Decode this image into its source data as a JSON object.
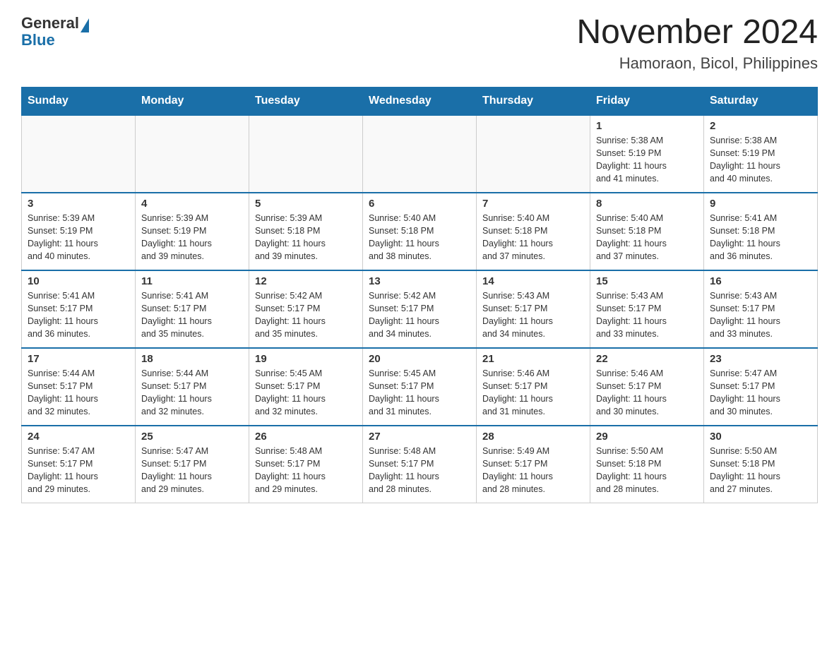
{
  "logo": {
    "general": "General",
    "blue": "Blue"
  },
  "header": {
    "month_year": "November 2024",
    "location": "Hamoraon, Bicol, Philippines"
  },
  "days_of_week": [
    "Sunday",
    "Monday",
    "Tuesday",
    "Wednesday",
    "Thursday",
    "Friday",
    "Saturday"
  ],
  "weeks": [
    [
      {
        "day": "",
        "info": ""
      },
      {
        "day": "",
        "info": ""
      },
      {
        "day": "",
        "info": ""
      },
      {
        "day": "",
        "info": ""
      },
      {
        "day": "",
        "info": ""
      },
      {
        "day": "1",
        "info": "Sunrise: 5:38 AM\nSunset: 5:19 PM\nDaylight: 11 hours\nand 41 minutes."
      },
      {
        "day": "2",
        "info": "Sunrise: 5:38 AM\nSunset: 5:19 PM\nDaylight: 11 hours\nand 40 minutes."
      }
    ],
    [
      {
        "day": "3",
        "info": "Sunrise: 5:39 AM\nSunset: 5:19 PM\nDaylight: 11 hours\nand 40 minutes."
      },
      {
        "day": "4",
        "info": "Sunrise: 5:39 AM\nSunset: 5:19 PM\nDaylight: 11 hours\nand 39 minutes."
      },
      {
        "day": "5",
        "info": "Sunrise: 5:39 AM\nSunset: 5:18 PM\nDaylight: 11 hours\nand 39 minutes."
      },
      {
        "day": "6",
        "info": "Sunrise: 5:40 AM\nSunset: 5:18 PM\nDaylight: 11 hours\nand 38 minutes."
      },
      {
        "day": "7",
        "info": "Sunrise: 5:40 AM\nSunset: 5:18 PM\nDaylight: 11 hours\nand 37 minutes."
      },
      {
        "day": "8",
        "info": "Sunrise: 5:40 AM\nSunset: 5:18 PM\nDaylight: 11 hours\nand 37 minutes."
      },
      {
        "day": "9",
        "info": "Sunrise: 5:41 AM\nSunset: 5:18 PM\nDaylight: 11 hours\nand 36 minutes."
      }
    ],
    [
      {
        "day": "10",
        "info": "Sunrise: 5:41 AM\nSunset: 5:17 PM\nDaylight: 11 hours\nand 36 minutes."
      },
      {
        "day": "11",
        "info": "Sunrise: 5:41 AM\nSunset: 5:17 PM\nDaylight: 11 hours\nand 35 minutes."
      },
      {
        "day": "12",
        "info": "Sunrise: 5:42 AM\nSunset: 5:17 PM\nDaylight: 11 hours\nand 35 minutes."
      },
      {
        "day": "13",
        "info": "Sunrise: 5:42 AM\nSunset: 5:17 PM\nDaylight: 11 hours\nand 34 minutes."
      },
      {
        "day": "14",
        "info": "Sunrise: 5:43 AM\nSunset: 5:17 PM\nDaylight: 11 hours\nand 34 minutes."
      },
      {
        "day": "15",
        "info": "Sunrise: 5:43 AM\nSunset: 5:17 PM\nDaylight: 11 hours\nand 33 minutes."
      },
      {
        "day": "16",
        "info": "Sunrise: 5:43 AM\nSunset: 5:17 PM\nDaylight: 11 hours\nand 33 minutes."
      }
    ],
    [
      {
        "day": "17",
        "info": "Sunrise: 5:44 AM\nSunset: 5:17 PM\nDaylight: 11 hours\nand 32 minutes."
      },
      {
        "day": "18",
        "info": "Sunrise: 5:44 AM\nSunset: 5:17 PM\nDaylight: 11 hours\nand 32 minutes."
      },
      {
        "day": "19",
        "info": "Sunrise: 5:45 AM\nSunset: 5:17 PM\nDaylight: 11 hours\nand 32 minutes."
      },
      {
        "day": "20",
        "info": "Sunrise: 5:45 AM\nSunset: 5:17 PM\nDaylight: 11 hours\nand 31 minutes."
      },
      {
        "day": "21",
        "info": "Sunrise: 5:46 AM\nSunset: 5:17 PM\nDaylight: 11 hours\nand 31 minutes."
      },
      {
        "day": "22",
        "info": "Sunrise: 5:46 AM\nSunset: 5:17 PM\nDaylight: 11 hours\nand 30 minutes."
      },
      {
        "day": "23",
        "info": "Sunrise: 5:47 AM\nSunset: 5:17 PM\nDaylight: 11 hours\nand 30 minutes."
      }
    ],
    [
      {
        "day": "24",
        "info": "Sunrise: 5:47 AM\nSunset: 5:17 PM\nDaylight: 11 hours\nand 29 minutes."
      },
      {
        "day": "25",
        "info": "Sunrise: 5:47 AM\nSunset: 5:17 PM\nDaylight: 11 hours\nand 29 minutes."
      },
      {
        "day": "26",
        "info": "Sunrise: 5:48 AM\nSunset: 5:17 PM\nDaylight: 11 hours\nand 29 minutes."
      },
      {
        "day": "27",
        "info": "Sunrise: 5:48 AM\nSunset: 5:17 PM\nDaylight: 11 hours\nand 28 minutes."
      },
      {
        "day": "28",
        "info": "Sunrise: 5:49 AM\nSunset: 5:17 PM\nDaylight: 11 hours\nand 28 minutes."
      },
      {
        "day": "29",
        "info": "Sunrise: 5:50 AM\nSunset: 5:18 PM\nDaylight: 11 hours\nand 28 minutes."
      },
      {
        "day": "30",
        "info": "Sunrise: 5:50 AM\nSunset: 5:18 PM\nDaylight: 11 hours\nand 27 minutes."
      }
    ]
  ]
}
